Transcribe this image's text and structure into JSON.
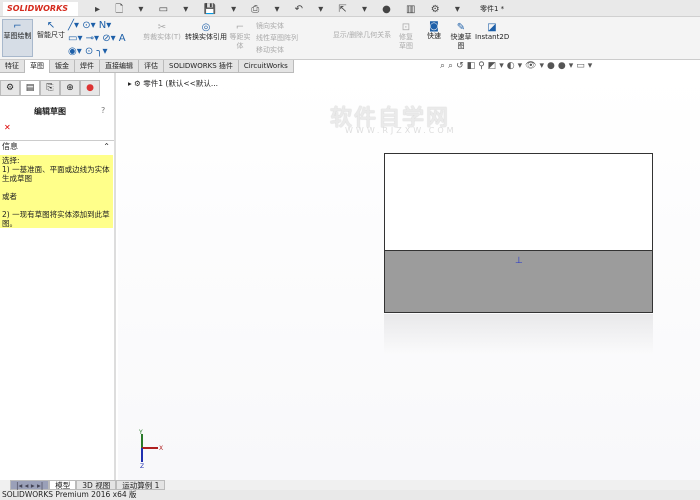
{
  "app": {
    "logo": "SOLIDWORKS",
    "document_title": "零件1 *"
  },
  "ribbon": {
    "sketch": "草图绘制",
    "smart_dim": "智能尺寸",
    "trim": "剪裁实体(T)",
    "convert": "转换实体引用",
    "offset": "等距实体",
    "mirror": "镜向实体",
    "linear_pattern": "线性草图阵列",
    "move": "移动实体",
    "relations": "显示/删除几何关系",
    "repair": "修复草图",
    "quick": "快速",
    "quick_sketch": "快速草图",
    "instant2d": "Instant2D"
  },
  "tabs": [
    "特征",
    "草图",
    "钣金",
    "焊件",
    "直接编辑",
    "评估",
    "SOLIDWORKS 插件",
    "CircuitWorks"
  ],
  "panel": {
    "title": "编辑草图",
    "info_header": "信息",
    "info_lines": [
      "选择:",
      "1) 一基准面、平面或边线为实体生成草图",
      "",
      "或者",
      "",
      "2) 一现有草图将实体添加到此草图。"
    ]
  },
  "tree": {
    "root": "零件1  (默认<<默认..."
  },
  "watermark": {
    "title": "软件自学网",
    "url": "WWW.RJZXW.COM"
  },
  "triad": {
    "x": "X",
    "y": "Y",
    "z": "Z"
  },
  "bottom_tabs": [
    "模型",
    "3D 视图",
    "运动算例 1"
  ],
  "status": "SOLIDWORKS Premium 2016 x64 版"
}
